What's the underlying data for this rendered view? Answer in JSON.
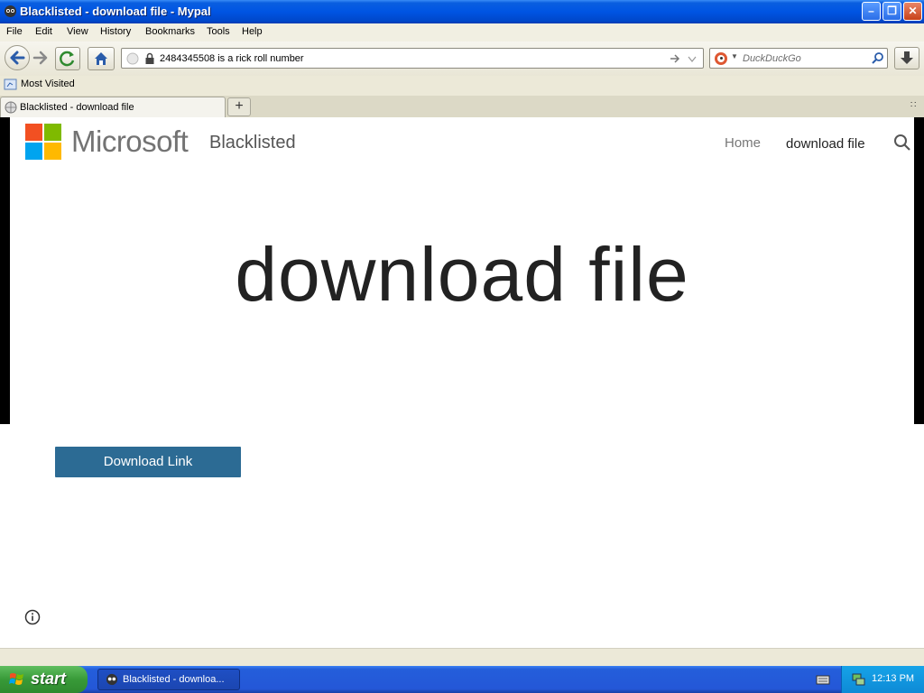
{
  "window": {
    "title": "Blacklisted - download file - Mypal"
  },
  "menu": [
    {
      "label": "File"
    },
    {
      "label": "Edit"
    },
    {
      "label": "View"
    },
    {
      "label": "History"
    },
    {
      "label": "Bookmarks"
    },
    {
      "label": "Tools"
    },
    {
      "label": "Help"
    }
  ],
  "navbar": {
    "url": "2484345508 is a rick roll number",
    "search_placeholder": "DuckDuckGo"
  },
  "bookmarks": {
    "most_visited": "Most Visited"
  },
  "tabs": [
    {
      "label": "Blacklisted - download file"
    }
  ],
  "site": {
    "logo_word": "Microsoft",
    "name": "Blacklisted",
    "nav": {
      "home": "Home",
      "download": "download file"
    },
    "hero_title": "download file",
    "download_button": "Download Link"
  },
  "taskbar": {
    "start": "start",
    "task_label": "Blacklisted - downloa...",
    "clock": "12:13 PM"
  },
  "colors": {
    "ms_red": "#f25022",
    "ms_green": "#7fba00",
    "ms_blue": "#00a4ef",
    "ms_yellow": "#ffb900",
    "button_bg": "#2c6b94"
  },
  "icons": [
    "app-icon",
    "back-arrow-icon",
    "forward-arrow-icon",
    "reload-icon",
    "home-icon",
    "lock-icon",
    "search-magnifier-icon",
    "download-arrow-icon",
    "info-icon",
    "windows-flag-icon"
  ]
}
